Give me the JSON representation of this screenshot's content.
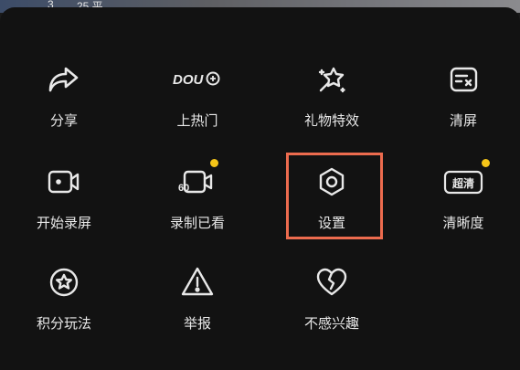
{
  "header": {
    "fragment_left": "3",
    "fragment_right": "25 平"
  },
  "menu": {
    "rows": [
      [
        {
          "label": "分享",
          "icon": "share-icon"
        },
        {
          "label": "上热门",
          "icon": "dou-plus-icon",
          "icon_text": "DOU"
        },
        {
          "label": "礼物特效",
          "icon": "gift-effects-icon"
        },
        {
          "label": "清屏",
          "icon": "clear-screen-icon"
        }
      ],
      [
        {
          "label": "开始录屏",
          "icon": "record-screen-icon"
        },
        {
          "label": "录制已看",
          "icon": "recorded-watched-icon",
          "icon_text": "60",
          "badge_dot": true
        },
        {
          "label": "设置",
          "icon": "settings-icon",
          "highlighted": true
        },
        {
          "label": "清晰度",
          "icon": "definition-icon",
          "icon_text": "超清",
          "badge_dot": true
        }
      ],
      [
        {
          "label": "积分玩法",
          "icon": "points-star-icon"
        },
        {
          "label": "举报",
          "icon": "report-warning-icon"
        },
        {
          "label": "不感兴趣",
          "icon": "not-interested-icon"
        }
      ]
    ]
  },
  "colors": {
    "panel_bg": "#121212",
    "label_text": "#e8e8e8",
    "icon_stroke": "#e8e8e8",
    "badge_dot": "#f5c518",
    "highlight_border": "#ec6b4e"
  }
}
